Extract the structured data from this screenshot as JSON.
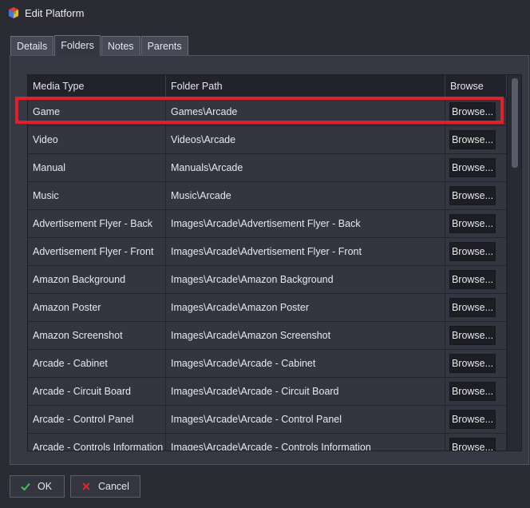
{
  "window": {
    "title": "Edit Platform",
    "icon": "launchbox-cube-icon"
  },
  "tabs": [
    {
      "label": "Details",
      "active": false
    },
    {
      "label": "Folders",
      "active": true
    },
    {
      "label": "Notes",
      "active": false
    },
    {
      "label": "Parents",
      "active": false
    }
  ],
  "grid": {
    "headers": [
      "Media Type",
      "Folder Path",
      "Browse"
    ],
    "rows": [
      {
        "media_type": "Game",
        "folder_path": "Games\\Arcade",
        "button": "Browse..."
      },
      {
        "media_type": "Video",
        "folder_path": "Videos\\Arcade",
        "button": "Browse..."
      },
      {
        "media_type": "Manual",
        "folder_path": "Manuals\\Arcade",
        "button": "Browse..."
      },
      {
        "media_type": "Music",
        "folder_path": "Music\\Arcade",
        "button": "Browse..."
      },
      {
        "media_type": "Advertisement Flyer - Back",
        "folder_path": "Images\\Arcade\\Advertisement Flyer - Back",
        "button": "Browse..."
      },
      {
        "media_type": "Advertisement Flyer - Front",
        "folder_path": "Images\\Arcade\\Advertisement Flyer - Front",
        "button": "Browse..."
      },
      {
        "media_type": "Amazon Background",
        "folder_path": "Images\\Arcade\\Amazon Background",
        "button": "Browse..."
      },
      {
        "media_type": "Amazon Poster",
        "folder_path": "Images\\Arcade\\Amazon Poster",
        "button": "Browse..."
      },
      {
        "media_type": "Amazon Screenshot",
        "folder_path": "Images\\Arcade\\Amazon Screenshot",
        "button": "Browse..."
      },
      {
        "media_type": "Arcade - Cabinet",
        "folder_path": "Images\\Arcade\\Arcade - Cabinet",
        "button": "Browse..."
      },
      {
        "media_type": "Arcade - Circuit Board",
        "folder_path": "Images\\Arcade\\Arcade - Circuit Board",
        "button": "Browse..."
      },
      {
        "media_type": "Arcade - Control Panel",
        "folder_path": "Images\\Arcade\\Arcade - Control Panel",
        "button": "Browse..."
      },
      {
        "media_type": "Arcade - Controls Information",
        "folder_path": "Images\\Arcade\\Arcade - Controls Information",
        "button": "Browse..."
      }
    ]
  },
  "footer": {
    "ok_label": "OK",
    "ok_icon": "checkmark-icon",
    "cancel_label": "Cancel",
    "cancel_icon": "x-icon"
  },
  "colors": {
    "highlight": "#e0202a",
    "ok_icon": "#3cc84a",
    "cancel_icon": "#d9262e"
  }
}
